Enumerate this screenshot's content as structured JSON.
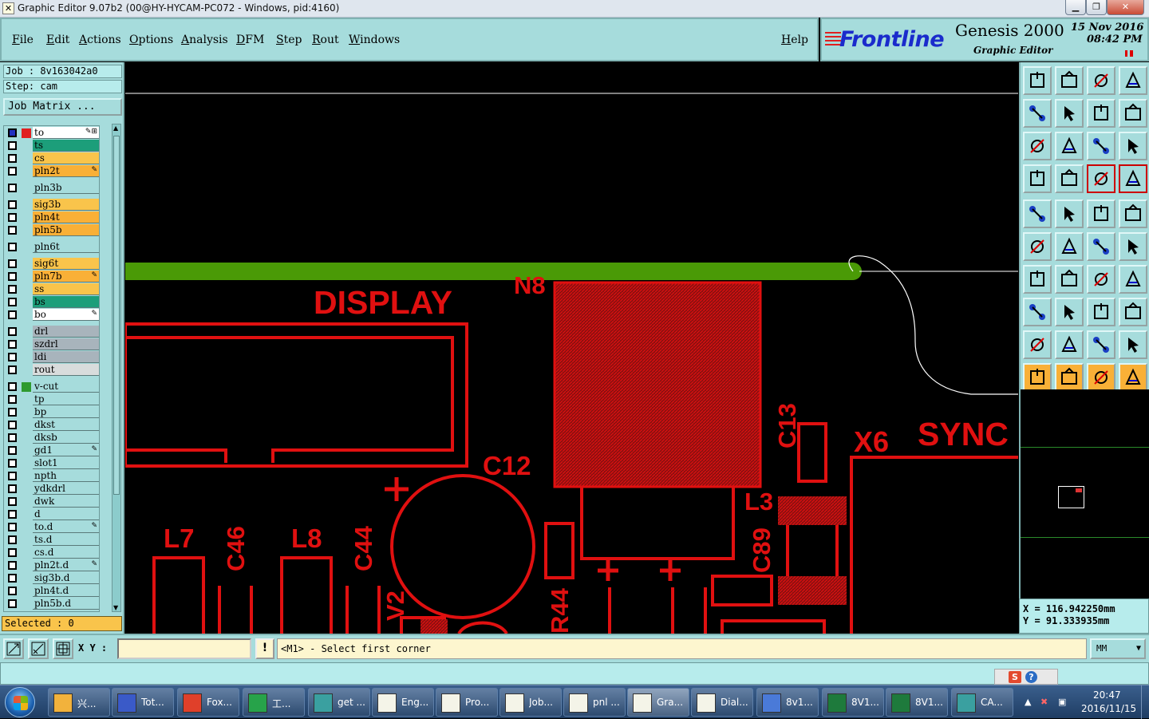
{
  "window": {
    "title": "Graphic Editor 9.07b2 (00@HY-HYCAM-PC072 - Windows, pid:4160)",
    "min_label": "▁",
    "max_label": "❐",
    "close_label": "✕"
  },
  "menu": {
    "file": "File",
    "edit": "Edit",
    "actions": "Actions",
    "options": "Options",
    "analysis": "Analysis",
    "dfm": "DFM",
    "step": "Step",
    "rout": "Rout",
    "windows": "Windows",
    "help": "Help"
  },
  "brand": {
    "logo": "Frontline",
    "product": "Genesis 2000",
    "subtitle": "Graphic Editor",
    "date": "15 Nov 2016",
    "time": "08:42 PM"
  },
  "left": {
    "job": "Job : 8v163042a0",
    "step": "Step: cam",
    "job_matrix": "Job Matrix ...",
    "selected": "Selected : 0"
  },
  "layers": [
    {
      "name": "to",
      "bg": "#ffffff",
      "swatch": "#e02020",
      "mark": "✎⊞",
      "chk_blue": true
    },
    {
      "name": "ts",
      "bg": "#1c9e7a",
      "swatch": "",
      "mark": ""
    },
    {
      "name": "cs",
      "bg": "#f9c44b",
      "swatch": "",
      "mark": ""
    },
    {
      "name": "pln2t",
      "bg": "#f9b037",
      "swatch": "",
      "mark": "✎"
    },
    {
      "name": "pln3b",
      "bg": "#a6dcdc",
      "swatch": "",
      "mark": ""
    },
    {
      "name": "sig3b",
      "bg": "#f9c44b",
      "swatch": "",
      "mark": ""
    },
    {
      "name": "pln4t",
      "bg": "#f9b037",
      "swatch": "",
      "mark": ""
    },
    {
      "name": "pln5b",
      "bg": "#f9b037",
      "swatch": "",
      "mark": ""
    },
    {
      "name": "pln6t",
      "bg": "#a6dcdc",
      "swatch": "",
      "mark": ""
    },
    {
      "name": "sig6t",
      "bg": "#f9c44b",
      "swatch": "",
      "mark": ""
    },
    {
      "name": "pln7b",
      "bg": "#f9b037",
      "swatch": "",
      "mark": "✎"
    },
    {
      "name": "ss",
      "bg": "#f9c44b",
      "swatch": "",
      "mark": ""
    },
    {
      "name": "bs",
      "bg": "#1c9e7a",
      "swatch": "",
      "mark": ""
    },
    {
      "name": "bo",
      "bg": "#ffffff",
      "swatch": "",
      "mark": "✎"
    },
    {
      "name": "drl",
      "bg": "#a8b4bc",
      "swatch": "",
      "mark": ""
    },
    {
      "name": "szdrl",
      "bg": "#a8b4bc",
      "swatch": "",
      "mark": ""
    },
    {
      "name": "ldi",
      "bg": "#a8b4bc",
      "swatch": "",
      "mark": ""
    },
    {
      "name": "rout",
      "bg": "#d8dcdc",
      "swatch": "",
      "mark": ""
    },
    {
      "name": "v-cut",
      "bg": "#a6dcdc",
      "swatch": "#2f9a2f",
      "mark": ""
    },
    {
      "name": "tp",
      "bg": "#a6dcdc",
      "swatch": "",
      "mark": ""
    },
    {
      "name": "bp",
      "bg": "#a6dcdc",
      "swatch": "",
      "mark": ""
    },
    {
      "name": "dkst",
      "bg": "#a6dcdc",
      "swatch": "",
      "mark": ""
    },
    {
      "name": "dksb",
      "bg": "#a6dcdc",
      "swatch": "",
      "mark": ""
    },
    {
      "name": "gd1",
      "bg": "#a6dcdc",
      "swatch": "",
      "mark": "✎"
    },
    {
      "name": "slot1",
      "bg": "#a6dcdc",
      "swatch": "",
      "mark": ""
    },
    {
      "name": "npth",
      "bg": "#a6dcdc",
      "swatch": "",
      "mark": ""
    },
    {
      "name": "ydkdrl",
      "bg": "#a6dcdc",
      "swatch": "",
      "mark": ""
    },
    {
      "name": "dwk",
      "bg": "#a6dcdc",
      "swatch": "",
      "mark": ""
    },
    {
      "name": "d",
      "bg": "#a6dcdc",
      "swatch": "",
      "mark": ""
    },
    {
      "name": "to.d",
      "bg": "#a6dcdc",
      "swatch": "",
      "mark": "✎"
    },
    {
      "name": "ts.d",
      "bg": "#a6dcdc",
      "swatch": "",
      "mark": ""
    },
    {
      "name": "cs.d",
      "bg": "#a6dcdc",
      "swatch": "",
      "mark": ""
    },
    {
      "name": "pln2t.d",
      "bg": "#a6dcdc",
      "swatch": "",
      "mark": "✎"
    },
    {
      "name": "sig3b.d",
      "bg": "#a6dcdc",
      "swatch": "",
      "mark": ""
    },
    {
      "name": "pln4t.d",
      "bg": "#a6dcdc",
      "swatch": "",
      "mark": ""
    },
    {
      "name": "pln5b.d",
      "bg": "#a6dcdc",
      "swatch": "",
      "mark": ""
    }
  ],
  "canvas": {
    "labels": {
      "display": "DISPLAY",
      "n8": "N8",
      "c12": "C12",
      "c13": "C13",
      "x6": "X6",
      "sync": "SYNC",
      "l3": "L3",
      "c89": "C89",
      "l7": "L7",
      "c46": "C46",
      "l8": "L8",
      "c44": "C44",
      "v2": "V2",
      "r44": "R44",
      "plus": "+"
    },
    "colors": {
      "copper": "#e01010",
      "trace": "#4a9a06",
      "outline": "#ffffff"
    }
  },
  "coords": {
    "x": "X = 116.942250mm",
    "y": "Y = 91.333935mm"
  },
  "status": {
    "xy_label": "X Y :",
    "xy_value": "",
    "alert": "!",
    "prompt": "<M1> - Select first corner",
    "units": "MM",
    "units_arrow": "▼"
  },
  "taskbar": {
    "items": [
      {
        "label": "兴...",
        "icon": "shell-icon"
      },
      {
        "label": "Tot...",
        "icon": "floppy-icon"
      },
      {
        "label": "Fox...",
        "icon": "foxit-icon"
      },
      {
        "label": "工...",
        "icon": "p-app-icon"
      },
      {
        "label": "get ...",
        "icon": "eye-icon"
      },
      {
        "label": "Eng...",
        "icon": "genesis-icon"
      },
      {
        "label": "Pro...",
        "icon": "genesis-icon"
      },
      {
        "label": "Job...",
        "icon": "genesis-icon"
      },
      {
        "label": "pnl ...",
        "icon": "genesis-icon"
      },
      {
        "label": "Gra...",
        "icon": "genesis-icon"
      },
      {
        "label": "Dial...",
        "icon": "genesis-icon"
      },
      {
        "label": "8v1...",
        "icon": "notepad-icon"
      },
      {
        "label": "8V1...",
        "icon": "excel-icon"
      },
      {
        "label": "8V1...",
        "icon": "excel-icon"
      },
      {
        "label": "CA...",
        "icon": "cam-icon"
      }
    ],
    "time": "20:47",
    "date": "2016/11/15"
  }
}
